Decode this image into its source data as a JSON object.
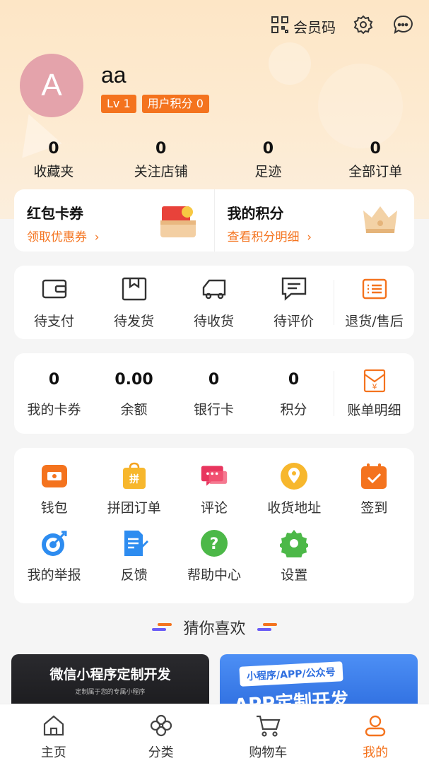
{
  "header": {
    "member_code_label": "会员码"
  },
  "profile": {
    "avatar_letter": "A",
    "username": "aa",
    "level_badge": "Lv 1",
    "points_badge": "用户积分 0"
  },
  "stats": [
    {
      "value": "0",
      "label": "收藏夹"
    },
    {
      "value": "0",
      "label": "关注店铺"
    },
    {
      "value": "0",
      "label": "足迹"
    },
    {
      "value": "0",
      "label": "全部订单"
    }
  ],
  "promo": {
    "coupons_title": "红包卡券",
    "coupons_sub": "领取优惠券",
    "points_title": "我的积分",
    "points_sub": "查看积分明细"
  },
  "orders": [
    {
      "label": "待支付",
      "icon": "wallet-icon"
    },
    {
      "label": "待发货",
      "icon": "box-icon"
    },
    {
      "label": "待收货",
      "icon": "truck-icon"
    },
    {
      "label": "待评价",
      "icon": "comment-icon"
    },
    {
      "label": "退货/售后",
      "icon": "list-icon"
    }
  ],
  "wallet": [
    {
      "value": "0",
      "label": "我的卡券"
    },
    {
      "value": "0.00",
      "label": "余额"
    },
    {
      "value": "0",
      "label": "银行卡"
    },
    {
      "value": "0",
      "label": "积分"
    }
  ],
  "bill_label": "账单明细",
  "tools": [
    {
      "label": "钱包",
      "icon": "wallet-color-icon"
    },
    {
      "label": "拼团订单",
      "icon": "group-buy-icon"
    },
    {
      "label": "评论",
      "icon": "chat-bubbles-icon"
    },
    {
      "label": "收货地址",
      "icon": "location-pin-icon"
    },
    {
      "label": "签到",
      "icon": "calendar-check-icon"
    },
    {
      "label": "我的举报",
      "icon": "target-icon"
    },
    {
      "label": "反馈",
      "icon": "document-edit-icon"
    },
    {
      "label": "帮助中心",
      "icon": "question-icon"
    },
    {
      "label": "设置",
      "icon": "gear-color-icon"
    }
  ],
  "guess_title": "猜你喜欢",
  "banners": {
    "left_title": "微信小程序定制开发",
    "left_sub": "定制属于您的专属小程序",
    "right_tag": "小程序/APP/公众号",
    "right_big": "APP定制开发"
  },
  "tabbar": [
    {
      "label": "主页",
      "icon": "home-icon"
    },
    {
      "label": "分类",
      "icon": "category-icon"
    },
    {
      "label": "购物车",
      "icon": "cart-icon"
    },
    {
      "label": "我的",
      "icon": "user-icon",
      "active": true
    }
  ],
  "colors": {
    "accent": "#f4731e",
    "hero_bg": "#fde6c6"
  }
}
